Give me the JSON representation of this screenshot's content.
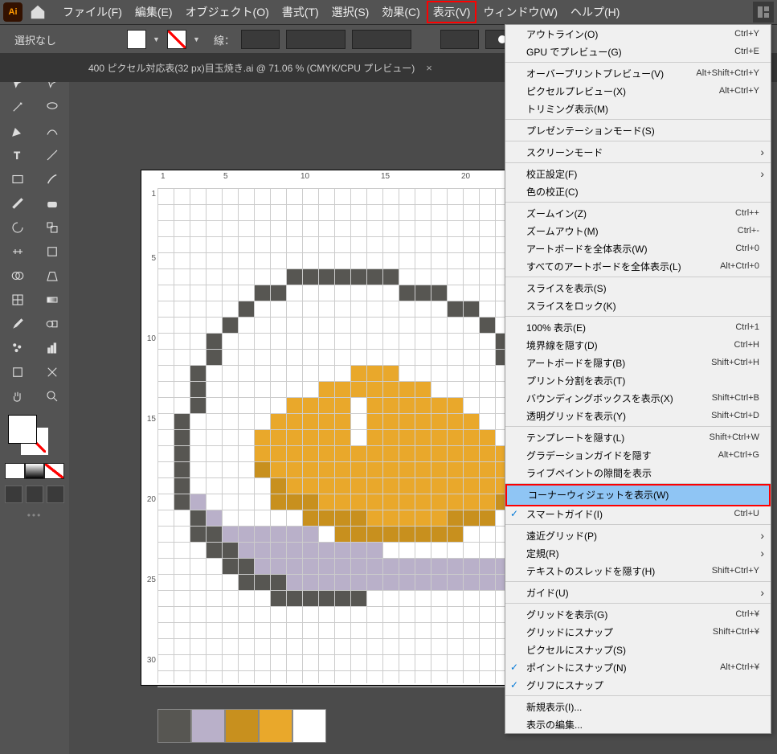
{
  "menubar": {
    "file": "ファイル(F)",
    "edit": "編集(E)",
    "object": "オブジェクト(O)",
    "type": "書式(T)",
    "select": "選択(S)",
    "effect": "効果(C)",
    "view": "表示(V)",
    "window": "ウィンドウ(W)",
    "help": "ヘルプ(H)"
  },
  "ctrl": {
    "selNone": "選択なし",
    "stroke": "線："
  },
  "tab": {
    "title": "400 ピクセル対応表(32 px)目玉焼き.ai @ 71.06 % (CMYK/CPU プレビュー)",
    "close": "×"
  },
  "ruler_h": {
    "r1": "1",
    "r5": "5",
    "r10": "10",
    "r15": "15",
    "r20": "20"
  },
  "ruler_v": {
    "r1": "1",
    "r5": "5",
    "r10": "10",
    "r15": "15",
    "r20": "20",
    "r25": "25",
    "r30": "30"
  },
  "palette_colors": [
    "#575652",
    "#B9B0C9",
    "#C8901E",
    "#E9A82B",
    "#FFFFFF"
  ],
  "view_menu": [
    {
      "l": "アウトライン(O)",
      "s": "Ctrl+Y"
    },
    {
      "l": "GPU でプレビュー(G)",
      "s": "Ctrl+E",
      "sep": true
    },
    {
      "l": "オーバープリントプレビュー(V)",
      "s": "Alt+Shift+Ctrl+Y"
    },
    {
      "l": "ピクセルプレビュー(X)",
      "s": "Alt+Ctrl+Y"
    },
    {
      "l": "トリミング表示(M)",
      "sep": true
    },
    {
      "l": "プレゼンテーションモード(S)",
      "sep": true
    },
    {
      "l": "スクリーンモード",
      "sub": true,
      "sep": true
    },
    {
      "l": "校正設定(F)",
      "sub": true
    },
    {
      "l": "色の校正(C)",
      "sep": true
    },
    {
      "l": "ズームイン(Z)",
      "s": "Ctrl++"
    },
    {
      "l": "ズームアウト(M)",
      "s": "Ctrl+-"
    },
    {
      "l": "アートボードを全体表示(W)",
      "s": "Ctrl+0"
    },
    {
      "l": "すべてのアートボードを全体表示(L)",
      "s": "Alt+Ctrl+0",
      "sep": true
    },
    {
      "l": "スライスを表示(S)"
    },
    {
      "l": "スライスをロック(K)",
      "sep": true
    },
    {
      "l": "100% 表示(E)",
      "s": "Ctrl+1"
    },
    {
      "l": "境界線を隠す(D)",
      "s": "Ctrl+H"
    },
    {
      "l": "アートボードを隠す(B)",
      "s": "Shift+Ctrl+H"
    },
    {
      "l": "プリント分割を表示(T)"
    },
    {
      "l": "バウンディングボックスを表示(X)",
      "s": "Shift+Ctrl+B"
    },
    {
      "l": "透明グリッドを表示(Y)",
      "s": "Shift+Ctrl+D",
      "sep": true
    },
    {
      "l": "テンプレートを隠す(L)",
      "s": "Shift+Ctrl+W"
    },
    {
      "l": "グラデーションガイドを隠す",
      "s": "Alt+Ctrl+G"
    },
    {
      "l": "ライブペイントの隙間を表示",
      "sep": true
    },
    {
      "l": "コーナーウィジェットを表示(W)",
      "hl": true,
      "sep": true
    },
    {
      "l": "スマートガイド(I)",
      "s": "Ctrl+U",
      "chk": true,
      "sep": true
    },
    {
      "l": "遠近グリッド(P)",
      "sub": true
    },
    {
      "l": "定規(R)",
      "sub": true
    },
    {
      "l": "テキストのスレッドを隠す(H)",
      "s": "Shift+Ctrl+Y",
      "sep": true
    },
    {
      "l": "ガイド(U)",
      "sub": true,
      "sep": true
    },
    {
      "l": "グリッドを表示(G)",
      "s": "Ctrl+¥"
    },
    {
      "l": "グリッドにスナップ",
      "s": "Shift+Ctrl+¥"
    },
    {
      "l": "ピクセルにスナップ(S)"
    },
    {
      "l": "ポイントにスナップ(N)",
      "s": "Alt+Ctrl+¥",
      "chk": true
    },
    {
      "l": "グリフにスナップ",
      "chk": true,
      "sep": true
    },
    {
      "l": "新規表示(I)..."
    },
    {
      "l": "表示の編集..."
    }
  ],
  "pixel_art": {
    "colors": {
      "d": "#575652",
      "l": "#B9B0C9",
      "o": "#E9A82B",
      "b": "#C8901E",
      "w": "#FFFFFF"
    },
    "rows": [
      "",
      "",
      "",
      "",
      "",
      "........ddddddd",
      "......dd.......ddd",
      ".....d............dd",
      "....d...............d",
      "...d.................d",
      "...d.................d",
      "..d.........ooo.......d",
      "..d.......ooooooo......",
      "..d.....oooowoooooo....",
      ".d.....ooooowooooooo...",
      ".d....oooooowoooooooo..",
      ".d....oooooooooooooooo.",
      ".d....booooooooooooooo.",
      ".d.....boooooooooooooo.",
      ".dl....bbbooooooooooob.",
      "..dl.....bbbbooooobbb..",
      "..ddllllll.bbbbbbbb....",
      "...ddlllllllll.........",
      "....ddlllllllllllllllll",
      ".....dddlllllllllllllll",
      ".......dddddd..........",
      "",
      "",
      ""
    ]
  }
}
